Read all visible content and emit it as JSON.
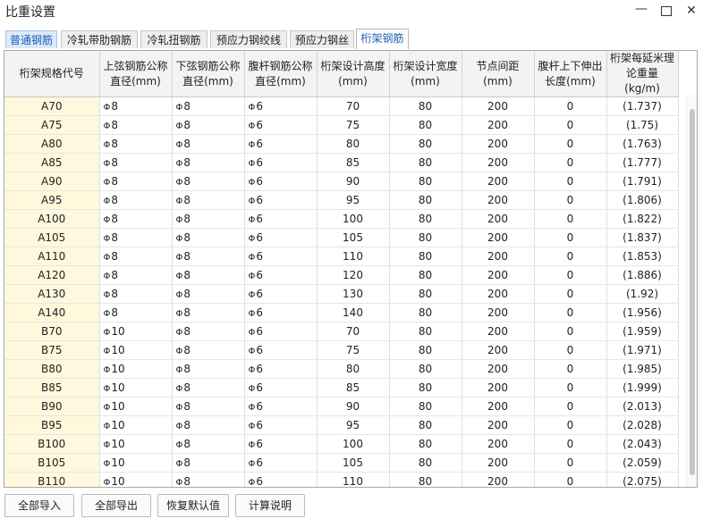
{
  "window": {
    "title": "比重设置",
    "minimize": "—",
    "close": "✕"
  },
  "tabs": [
    "普通钢筋",
    "冷轧带肋钢筋",
    "冷轧扭钢筋",
    "预应力钢绞线",
    "预应力钢丝",
    "桁架钢筋"
  ],
  "active_tab": "桁架钢筋",
  "symbols": {
    "hrb": "Φ",
    "hpb": "Φ"
  },
  "table": {
    "headers": [
      "桁架规格代号",
      "上弦钢筋公称直径(mm)",
      "下弦钢筋公称直径(mm)",
      "腹杆钢筋公称直径(mm)",
      "桁架设计高度(mm)",
      "桁架设计宽度(mm)",
      "节点间距(mm)",
      "腹杆上下伸出长度(mm)",
      "桁架每延米理论重量(kg/m)"
    ],
    "rows": [
      [
        "A70",
        "8",
        "8",
        "6",
        "70",
        "80",
        "200",
        "0",
        "(1.737)"
      ],
      [
        "A75",
        "8",
        "8",
        "6",
        "75",
        "80",
        "200",
        "0",
        "(1.75)"
      ],
      [
        "A80",
        "8",
        "8",
        "6",
        "80",
        "80",
        "200",
        "0",
        "(1.763)"
      ],
      [
        "A85",
        "8",
        "8",
        "6",
        "85",
        "80",
        "200",
        "0",
        "(1.777)"
      ],
      [
        "A90",
        "8",
        "8",
        "6",
        "90",
        "80",
        "200",
        "0",
        "(1.791)"
      ],
      [
        "A95",
        "8",
        "8",
        "6",
        "95",
        "80",
        "200",
        "0",
        "(1.806)"
      ],
      [
        "A100",
        "8",
        "8",
        "6",
        "100",
        "80",
        "200",
        "0",
        "(1.822)"
      ],
      [
        "A105",
        "8",
        "8",
        "6",
        "105",
        "80",
        "200",
        "0",
        "(1.837)"
      ],
      [
        "A110",
        "8",
        "8",
        "6",
        "110",
        "80",
        "200",
        "0",
        "(1.853)"
      ],
      [
        "A120",
        "8",
        "8",
        "6",
        "120",
        "80",
        "200",
        "0",
        "(1.886)"
      ],
      [
        "A130",
        "8",
        "8",
        "6",
        "130",
        "80",
        "200",
        "0",
        "(1.92)"
      ],
      [
        "A140",
        "8",
        "8",
        "6",
        "140",
        "80",
        "200",
        "0",
        "(1.956)"
      ],
      [
        "B70",
        "10",
        "8",
        "6",
        "70",
        "80",
        "200",
        "0",
        "(1.959)"
      ],
      [
        "B75",
        "10",
        "8",
        "6",
        "75",
        "80",
        "200",
        "0",
        "(1.971)"
      ],
      [
        "B80",
        "10",
        "8",
        "6",
        "80",
        "80",
        "200",
        "0",
        "(1.985)"
      ],
      [
        "B85",
        "10",
        "8",
        "6",
        "85",
        "80",
        "200",
        "0",
        "(1.999)"
      ],
      [
        "B90",
        "10",
        "8",
        "6",
        "90",
        "80",
        "200",
        "0",
        "(2.013)"
      ],
      [
        "B95",
        "10",
        "8",
        "6",
        "95",
        "80",
        "200",
        "0",
        "(2.028)"
      ],
      [
        "B100",
        "10",
        "8",
        "6",
        "100",
        "80",
        "200",
        "0",
        "(2.043)"
      ],
      [
        "B105",
        "10",
        "8",
        "6",
        "105",
        "80",
        "200",
        "0",
        "(2.059)"
      ],
      [
        "B110",
        "10",
        "8",
        "6",
        "110",
        "80",
        "200",
        "0",
        "(2.075)"
      ]
    ]
  },
  "buttons": {
    "import_all": "全部导入",
    "export_all": "全部导出",
    "restore_default": "恢复默认值",
    "calc_help": "计算说明"
  },
  "colors": {
    "code_cell_bg": "#fff8dc",
    "header_bg": "#f3f3f3",
    "highlight_tab_text": "#1a5fb4"
  }
}
